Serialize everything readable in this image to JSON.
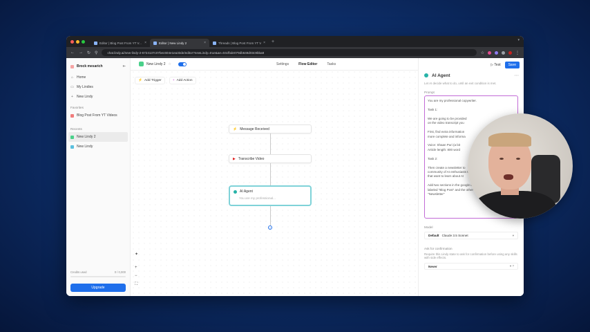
{
  "browser": {
    "tabs": [
      {
        "label": "Editor | Blog Post From YT V...",
        "active": false
      },
      {
        "label": "Editor | New Lindy 2",
        "active": true
      },
      {
        "label": "Threads | Blog Post From YT V...",
        "active": false
      }
    ],
    "url": "chat.lindy.ai/new-lindy-2-6724137c07bec604e1ea33de/editor?newLindy=true&ae=04cfbde079db648d03c9bba8"
  },
  "sidebar": {
    "workspace": "Brock mesarich",
    "items": [
      {
        "label": "Home",
        "icon": "home-icon"
      },
      {
        "label": "My Lindies",
        "icon": "folder-icon"
      },
      {
        "label": "New Lindy",
        "icon": "plus-icon"
      }
    ],
    "favorites_label": "Favorites",
    "favorites": [
      {
        "label": "Blog Post From YT Videos"
      }
    ],
    "recents_label": "Recents",
    "recents": [
      {
        "label": "New Lindy 2"
      },
      {
        "label": "New Lindy"
      }
    ],
    "credits_label": "Credits used",
    "credits_value": "0 / 0,000",
    "upgrade_label": "Upgrade"
  },
  "topbar": {
    "lindy_name": "New Lindy 2",
    "settings": "Settings",
    "flow_editor": "Flow Editor",
    "tasks": "Tasks",
    "test": "Test",
    "save": "Save"
  },
  "canvas": {
    "add_trigger": "Add Trigger",
    "add_action": "Add Action",
    "nodes": {
      "message": "Message Received",
      "transcribe": "Transcribe Video",
      "agent": "AI Agent",
      "agent_sub": "You are my professional..."
    }
  },
  "panel": {
    "title": "AI Agent",
    "desc": "Let AI decide what to do, until an exit condition is met.",
    "prompt_label": "Prompt",
    "prompt_lines": [
      "You are my professional copywriter.",
      "Task 1:",
      "We are going to be provided\non the video transcript you",
      "First, find extra information\nmore complete and informa",
      "Voice: Shaan Puri (a bit\nArticle length: 800 word",
      "Task 2:",
      "Then create a newsletter to\ncommunity of AI enthusiasts th\nthat want to learn about AI",
      "Add two sections in the google doc. One\nlabeled \"Blog Post\" and the other labeled\n\"Newsletter\""
    ],
    "model_label": "Model",
    "model_default": "Default",
    "model_value": "Claude 3.5 Sonnet",
    "confirm_label": "Ask for confirmation",
    "confirm_desc": "Require this Lindy state to ask for confirmation before using any skills with side effects.",
    "confirm_value": "Never"
  },
  "colors": {
    "accent": "#1f6feb",
    "agent_border": "#7fd2d8",
    "prompt_border": "#c26ad6"
  }
}
